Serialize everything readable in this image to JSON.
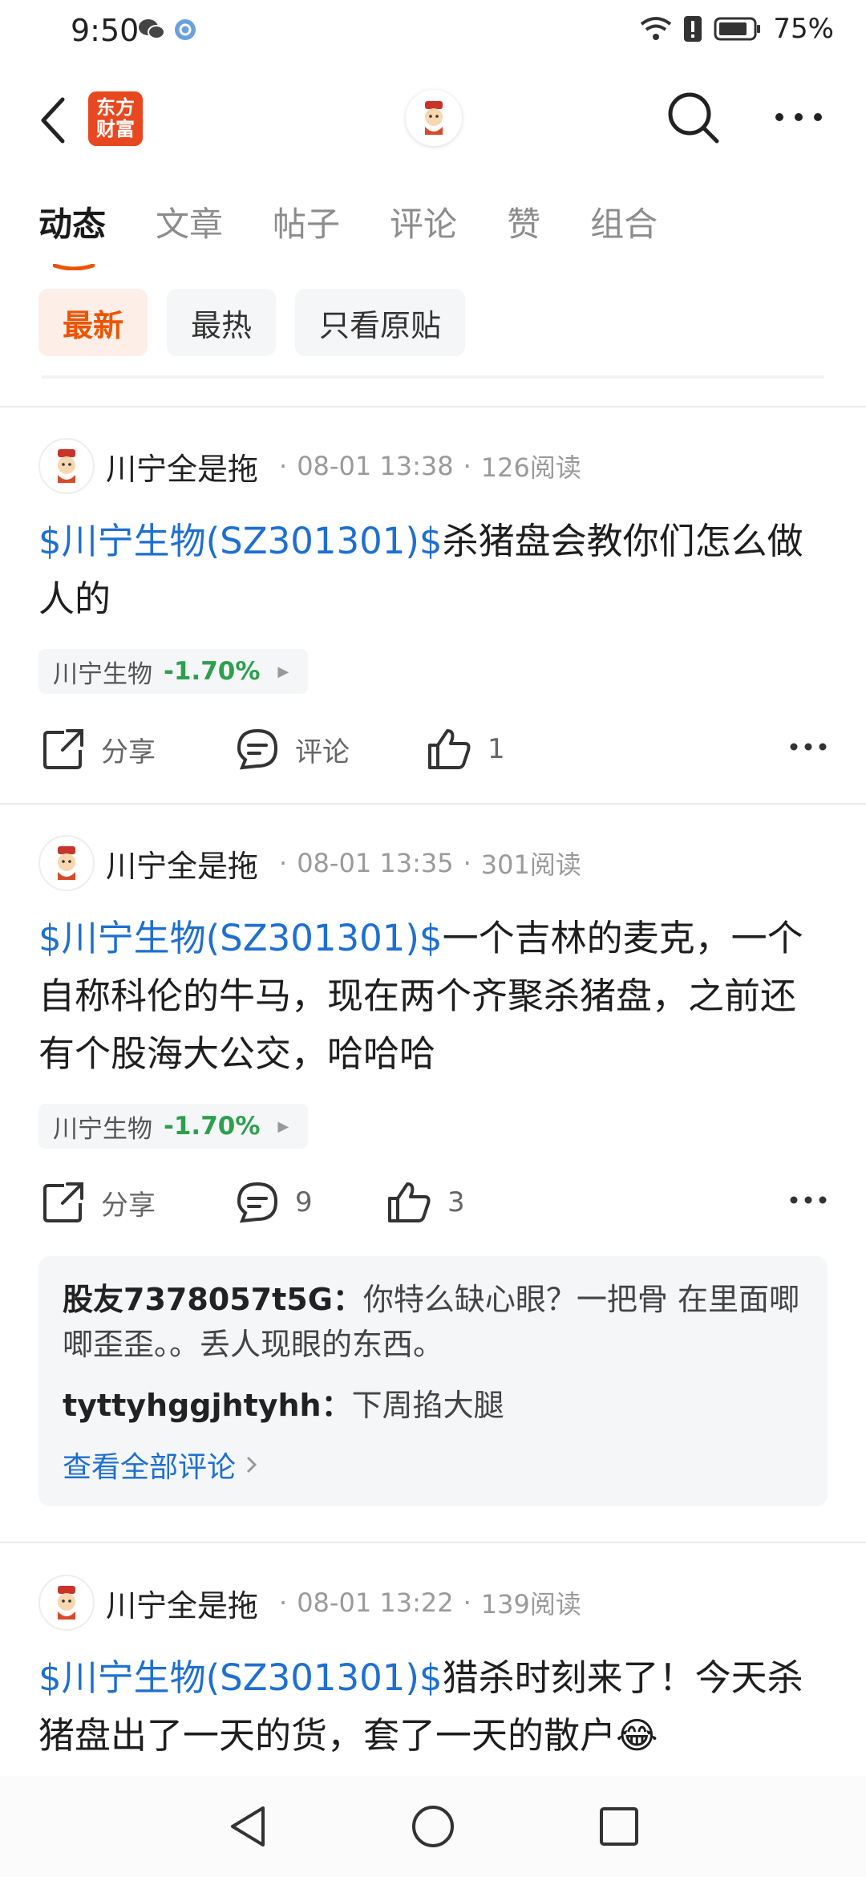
{
  "status_bar": {
    "time": "9:50",
    "battery": "75%"
  },
  "nav": {
    "brand_line1": "东方",
    "brand_line2": "财富"
  },
  "tabs": [
    {
      "label": "动态"
    },
    {
      "label": "文章"
    },
    {
      "label": "帖子"
    },
    {
      "label": "评论"
    },
    {
      "label": "赞"
    },
    {
      "label": "组合"
    }
  ],
  "filters": [
    {
      "label": "最新"
    },
    {
      "label": "最热"
    },
    {
      "label": "只看原贴"
    }
  ],
  "posts": [
    {
      "author": "川宁全是拖",
      "time": "08-01 13:38",
      "reads": "126阅读",
      "stock_link": "$川宁生物(SZ301301)$",
      "text": "杀猪盘会教你们怎么做人的",
      "tag_name": "川宁生物",
      "tag_change": "-1.70%",
      "share": "分享",
      "comment": "评论",
      "likes": "1"
    },
    {
      "author": "川宁全是拖",
      "time": "08-01 13:35",
      "reads": "301阅读",
      "stock_link": "$川宁生物(SZ301301)$",
      "text": "一个吉林的麦克，一个自称科伦的牛马，现在两个齐聚杀猪盘，之前还有个股海大公交，哈哈哈",
      "tag_name": "川宁生物",
      "tag_change": "-1.70%",
      "share": "分享",
      "comment": "9",
      "likes": "3",
      "comments": [
        {
          "author": "股友7378057t5G",
          "sep": "：",
          "text": "你特么缺心眼？一把骨 在里面唧唧歪歪。。丢人现眼的东西。"
        },
        {
          "author": "tyttyhggjhtyhh",
          "sep": "：",
          "text": "下周掐大腿"
        }
      ],
      "view_all": "查看全部评论"
    },
    {
      "author": "川宁全是拖",
      "time": "08-01 13:22",
      "reads": "139阅读",
      "stock_link": "$川宁生物(SZ301301)$",
      "text": "猎杀时刻来了！今天杀猪盘出了一天的货，套了一天的散户😂"
    }
  ]
}
